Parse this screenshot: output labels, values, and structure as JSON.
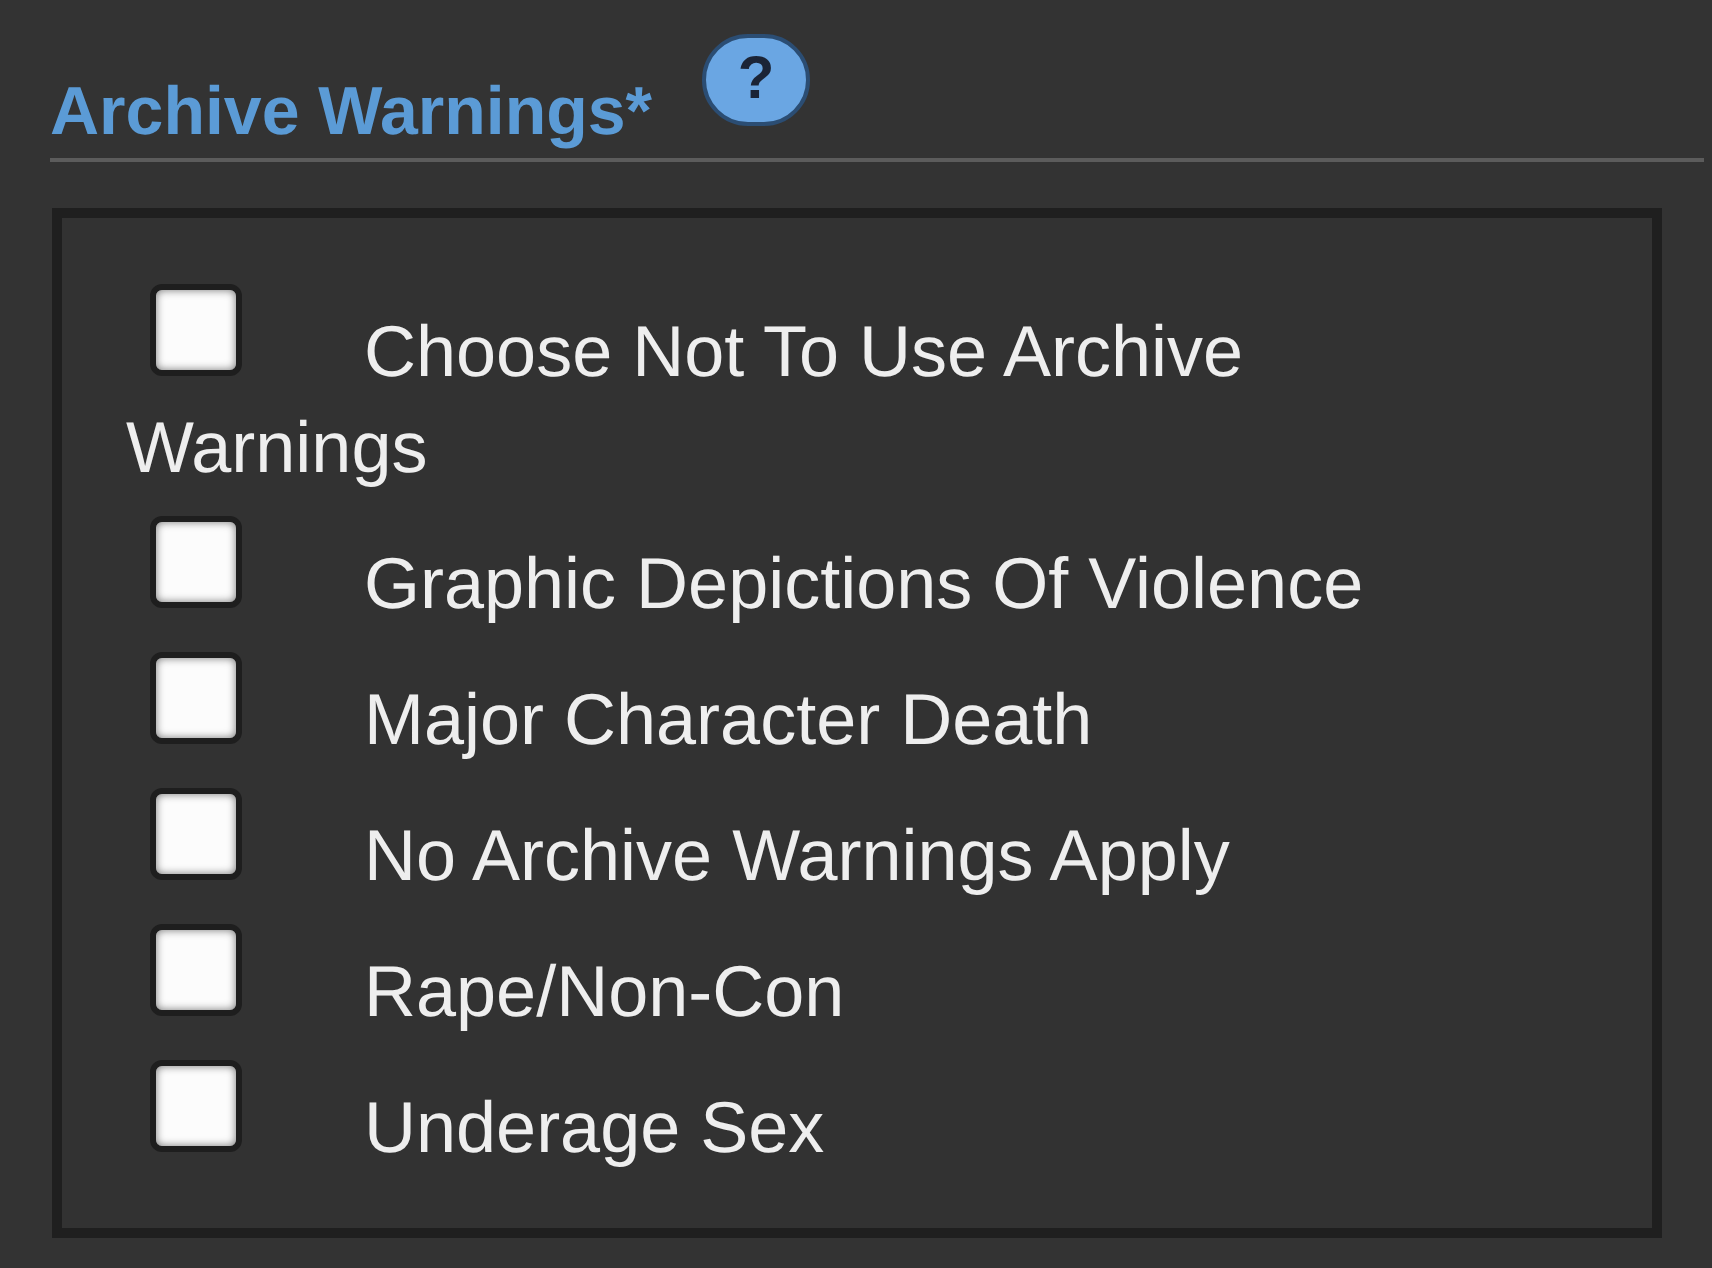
{
  "section": {
    "title": "Archive Warnings*",
    "help_button": "?"
  },
  "warnings": [
    {
      "lines": [
        "Choose Not To Use Archive",
        "Warnings"
      ],
      "checked": false
    },
    {
      "lines": [
        "Graphic Depictions Of Violence"
      ],
      "checked": false
    },
    {
      "lines": [
        "Major Character Death"
      ],
      "checked": false
    },
    {
      "lines": [
        "No Archive Warnings Apply"
      ],
      "checked": false
    },
    {
      "lines": [
        "Rape/Non-Con"
      ],
      "checked": false
    },
    {
      "lines": [
        "Underage Sex"
      ],
      "checked": false
    }
  ]
}
